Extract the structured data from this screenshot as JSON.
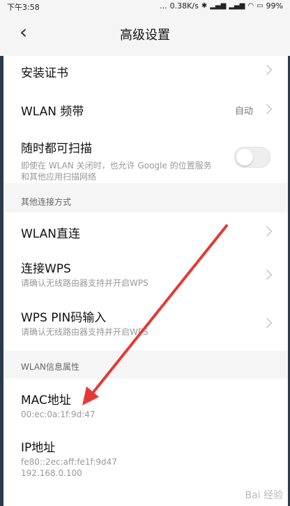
{
  "status": {
    "time": "下午3:58",
    "dots": "...",
    "speed": "0.38K/s",
    "battery": "99%"
  },
  "header": {
    "title": "高级设置"
  },
  "items": {
    "install_cert": "安装证书",
    "wlan_band": "WLAN 频带",
    "wlan_band_value": "自动",
    "scan": {
      "label": "随时都可扫描",
      "sub1": "即使在 WLAN 关闭时，也允许 Google 的位置服务",
      "sub2": "和其他应用扫描网络"
    }
  },
  "sections": {
    "other_connect": "其他连接方式",
    "wlan_info": "WLAN信息属性"
  },
  "other": {
    "direct": "WLAN直连",
    "wps": "连接WPS",
    "wps_sub": "请确认无线路由器支持并开启WPS",
    "wps_pin": "WPS PIN码输入",
    "wps_pin_sub": "请确认无线路由器支持并开启WPS"
  },
  "info": {
    "mac_label": "MAC地址",
    "mac_value": "00:ec:0a:1f:9d:47",
    "ip_label": "IP地址",
    "ip_v6": "fe80::2ec:aff:fe1f:9d47",
    "ip_v4": "192.168.0.100"
  },
  "watermark": "Bai 经验",
  "colors": {
    "arrow": "#e53935"
  }
}
